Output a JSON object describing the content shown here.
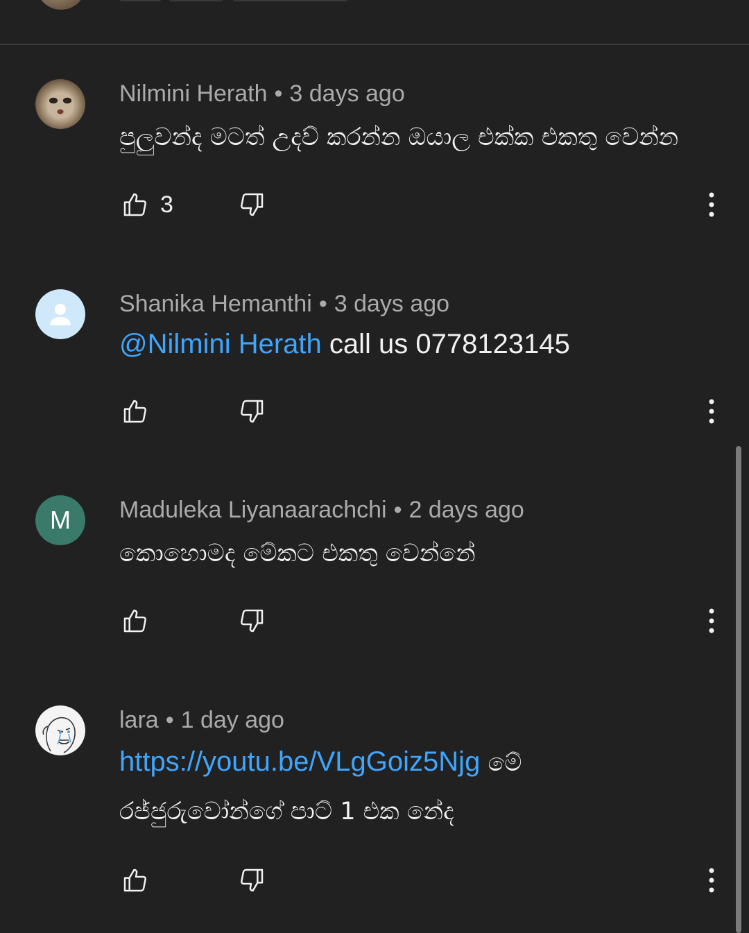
{
  "comments": [
    {
      "author": "Nilmini Herath",
      "time": "3 days ago",
      "text": "පුලුවන්ද මටත් උදව් කරන්න ඔයාල එක්ක එකතු වෙන්න",
      "like_count": "3",
      "avatar": "cat-photo"
    },
    {
      "author": "Shanika Hemanthi",
      "time": "3 days ago",
      "mention": "@Nilmini Herath",
      "text": "call us 0778123145",
      "like_count": "",
      "avatar": "person-icon"
    },
    {
      "author": "Maduleka Liyanaarachchi",
      "time": "2 days ago",
      "text": "කොහොමද මේකට එකතු වෙන්නේ",
      "like_count": "",
      "avatar_initial": "M"
    },
    {
      "author": "lara",
      "time": "1 day ago",
      "link": "https://youtu.be/VLgGoiz5Njg",
      "text_line1_suffix": "මේ",
      "text_line2": "රජ්ජුරුවෝන්ගේ පාට් 1 එක නේද",
      "like_count": "",
      "avatar": "sketch-face"
    }
  ],
  "separator": "•",
  "icons": {
    "like": "thumb-up-icon",
    "dislike": "thumb-down-icon",
    "more": "more-vert-icon"
  },
  "colors": {
    "background": "#212121",
    "link": "#3ea6ff",
    "meta": "#aaaaaa",
    "text": "#f1f1f1",
    "initial_avatar": "#3a7a6b"
  }
}
